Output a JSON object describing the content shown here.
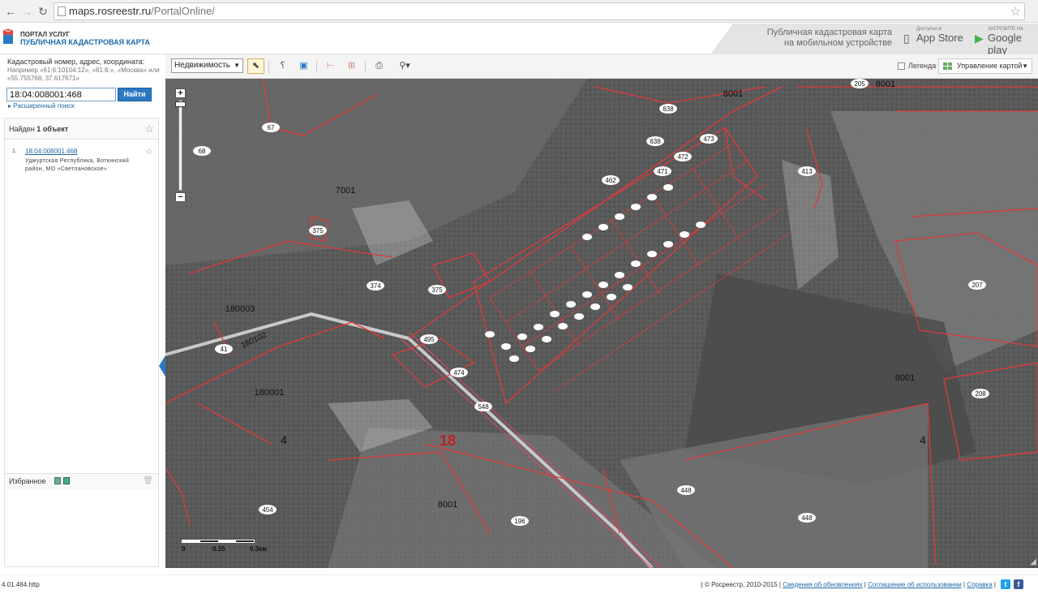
{
  "browser": {
    "url_domain": "maps.rosreestr.ru",
    "url_path": "/PortalOnline/"
  },
  "header": {
    "logo_line1": "ПОРТАЛ УСЛУГ",
    "logo_line2": "ПУБЛИЧНАЯ КАДАСТРОВАЯ КАРТА",
    "mobile_text_1": "Публичная кадастровая карта",
    "mobile_text_2": "на мобильном устройстве",
    "appstore_small": "Доступно в",
    "appstore_big": "App Store",
    "gplay_small": "ЗАГРУЗИТЕ НА",
    "gplay_big": "Google play"
  },
  "sidebar": {
    "search_label": "Кадастровый номер, адрес, координата:",
    "search_hint": "Например «61:6:10104:12», «61:6:», «Москва» или «55.755768, 37.617671»",
    "search_value": "18:04:008001:468",
    "search_button": "Найти",
    "advanced_link": "Расширенный поиск",
    "found_prefix": "Найден",
    "found_count": "1 объект",
    "results": [
      {
        "num": "1.",
        "cadastral": "18:04:008001:468",
        "address": "Удмуртская Республика, Воткинский район, МО «Светлановское»"
      }
    ],
    "favorites_label": "Избранное"
  },
  "toolbar": {
    "layer_select": "Недвижимость",
    "legend_label": "Легенда",
    "map_management": "Управление картой"
  },
  "map": {
    "labels": [
      {
        "text": "8001"
      },
      {
        "text": "8001"
      },
      {
        "text": "8001"
      },
      {
        "text": "8001"
      },
      {
        "text": "7001"
      },
      {
        "text": "18"
      },
      {
        "text": "4"
      },
      {
        "text": "4"
      },
      {
        "text": "180003"
      },
      {
        "text": "180102"
      },
      {
        "text": "180001"
      },
      {
        "text": "638"
      },
      {
        "text": "638"
      },
      {
        "text": "205"
      },
      {
        "text": "207"
      },
      {
        "text": "208"
      },
      {
        "text": "448"
      },
      {
        "text": "448"
      },
      {
        "text": "474"
      },
      {
        "text": "454"
      },
      {
        "text": "495"
      },
      {
        "text": "375"
      },
      {
        "text": "374"
      },
      {
        "text": "548"
      },
      {
        "text": "196"
      },
      {
        "text": "68"
      },
      {
        "text": "67"
      },
      {
        "text": "413"
      },
      {
        "text": "462"
      },
      {
        "text": "473"
      },
      {
        "text": "472"
      },
      {
        "text": "471"
      },
      {
        "text": "375"
      },
      {
        "text": "41"
      }
    ],
    "scale": [
      "0",
      "0.15",
      "0.3км"
    ]
  },
  "status": {
    "left": "4.01.484.http"
  },
  "footer": {
    "copyright": "| © Росреестр, 2010-2015 |",
    "updates": "Сведения об обновлениях",
    "terms": "Соглашение об использовании",
    "help": "Справка"
  }
}
